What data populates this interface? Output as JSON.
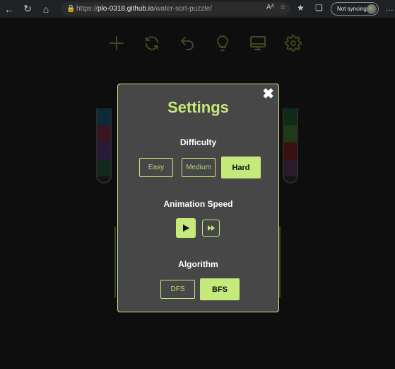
{
  "browser": {
    "url_scheme": "https://",
    "url_host": "plo-0318.github.io",
    "url_path": "/water-sort-puzzle/",
    "sync_label": "Not syncing",
    "read_aloud": "Aᴬ",
    "more": "…"
  },
  "toolbar": {
    "icons": [
      "plus-icon",
      "restart-icon",
      "undo-icon",
      "hint-bulb-icon",
      "display-icon",
      "settings-gear-icon"
    ]
  },
  "tubes": {
    "left": [
      "#0d2a3a",
      "#3a1420",
      "#2a1a3a",
      "#0f2a1c"
    ],
    "right": [
      "#0f2a18",
      "#1e3a18",
      "#3a1010",
      "#2a1a2a"
    ]
  },
  "settings": {
    "title": "Settings",
    "close_label": "✖",
    "difficulty": {
      "label": "Difficulty",
      "options": [
        "Easy",
        "Medium",
        "Hard"
      ],
      "selected": "Hard"
    },
    "animation_speed": {
      "label": "Animation Speed",
      "options": [
        "normal",
        "fast"
      ],
      "selected": "normal"
    },
    "algorithm": {
      "label": "Algorithm",
      "options": [
        "DFS",
        "BFS"
      ],
      "selected": "BFS"
    }
  },
  "colors": {
    "accent": "#c5e97a",
    "modal_bg": "#474747",
    "page_bg": "#0e0e0e"
  }
}
